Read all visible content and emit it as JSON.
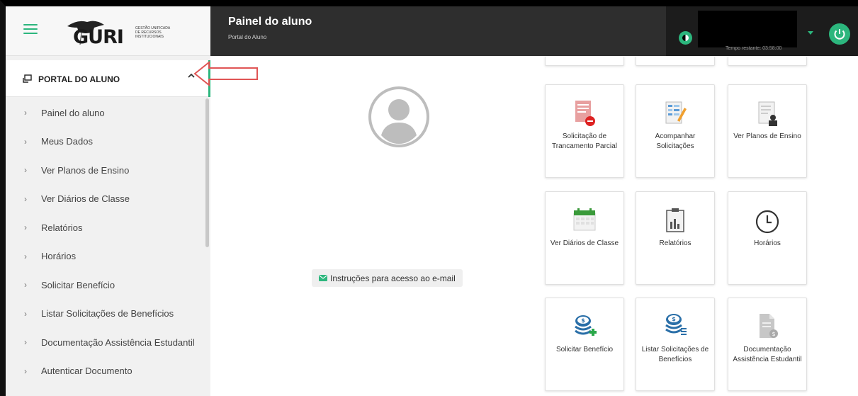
{
  "app": {
    "logo_text": "GURI",
    "logo_subtitle": "GESTÃO UNIFICADA DE RECURSOS INSTITUCIONAIS"
  },
  "header": {
    "title": "Painel do aluno",
    "subtitle": "Portal do Aluno",
    "timer": "Tempo restante: 03:58:00"
  },
  "sidebar": {
    "section_label": "PORTAL DO ALUNO",
    "items": [
      {
        "label": "Painel do aluno"
      },
      {
        "label": "Meus Dados"
      },
      {
        "label": "Ver Planos de Ensino"
      },
      {
        "label": "Ver Diários de Classe"
      },
      {
        "label": "Relatórios"
      },
      {
        "label": "Horários"
      },
      {
        "label": "Solicitar Benefício"
      },
      {
        "label": "Listar Solicitações de Benefícios"
      },
      {
        "label": "Documentação Assistência Estudantil"
      },
      {
        "label": "Autenticar Documento"
      }
    ]
  },
  "main": {
    "email_link": "Instruções para acesso ao e-mail",
    "tiles": [
      {
        "label": "Solicitação de Trancamento Parcial",
        "icon": "document-remove-icon"
      },
      {
        "label": "Acompanhar Solicitações",
        "icon": "document-edit-icon"
      },
      {
        "label": "Ver Planos de Ensino",
        "icon": "document-teacher-icon"
      },
      {
        "label": "Ver Diários de Classe",
        "icon": "calendar-icon"
      },
      {
        "label": "Relatórios",
        "icon": "report-chart-icon"
      },
      {
        "label": "Horários",
        "icon": "clock-icon"
      },
      {
        "label": "Solicitar Benefício",
        "icon": "coins-add-icon"
      },
      {
        "label": "Listar Solicitações de Benefícios",
        "icon": "coins-list-icon"
      },
      {
        "label": "Documentação Assistência Estudantil",
        "icon": "document-money-icon"
      }
    ]
  },
  "colors": {
    "accent": "#2cb67d",
    "topbar": "#2e2e2e",
    "sidebar": "#f1f1f1",
    "annotation": "#e05555"
  }
}
